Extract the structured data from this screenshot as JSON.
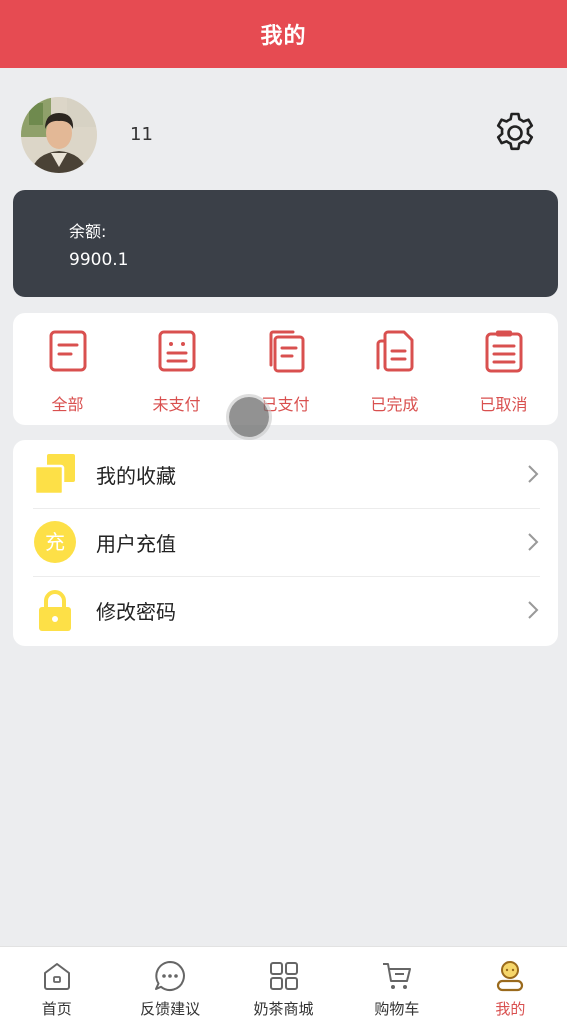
{
  "header": {
    "title": "我的"
  },
  "profile": {
    "username": "11"
  },
  "balance": {
    "label": "余额:",
    "value": "9900.1"
  },
  "orders": [
    {
      "label": "全部",
      "icon": "order-all-icon"
    },
    {
      "label": "未支付",
      "icon": "order-unpaid-icon"
    },
    {
      "label": "已支付",
      "icon": "order-paid-icon"
    },
    {
      "label": "已完成",
      "icon": "order-completed-icon"
    },
    {
      "label": "已取消",
      "icon": "order-cancelled-icon"
    }
  ],
  "menu": [
    {
      "label": "我的收藏",
      "icon": "favorites-icon"
    },
    {
      "label": "用户充值",
      "icon": "recharge-icon",
      "icon_text": "充"
    },
    {
      "label": "修改密码",
      "icon": "lock-icon"
    }
  ],
  "tabs": [
    {
      "label": "首页",
      "icon": "home-icon"
    },
    {
      "label": "反馈建议",
      "icon": "feedback-icon"
    },
    {
      "label": "奶茶商城",
      "icon": "grid-icon"
    },
    {
      "label": "购物车",
      "icon": "cart-icon"
    },
    {
      "label": "我的",
      "icon": "profile-icon",
      "active": true
    }
  ],
  "colors": {
    "header_bg": "#e64b52",
    "accent_red": "#d9504f",
    "balance_card_bg": "#3b4048",
    "menu_icon_yellow": "#fde047",
    "active_tab_icon": "#e8b53a"
  }
}
